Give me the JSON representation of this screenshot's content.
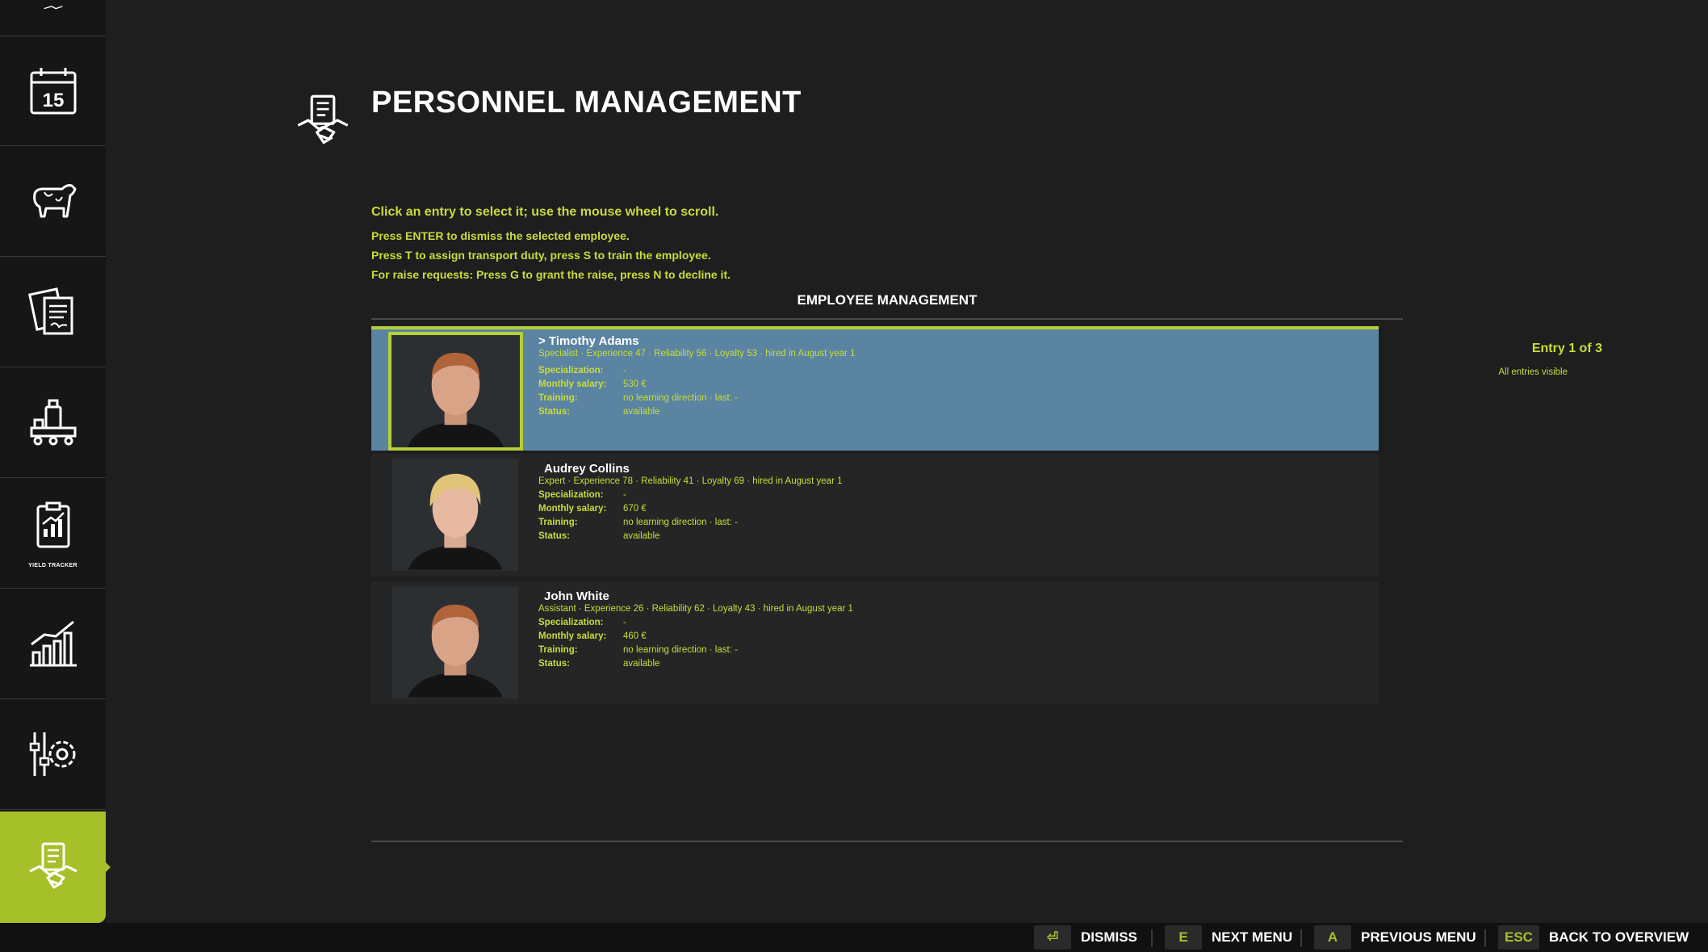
{
  "header": {
    "title": "PERSONNEL MANAGEMENT"
  },
  "sidebar": {
    "items": [
      {
        "name": "calendar",
        "icon": "calendar-icon",
        "text": "15"
      },
      {
        "name": "animals",
        "icon": "cow-icon"
      },
      {
        "name": "contracts",
        "icon": "contracts-icon"
      },
      {
        "name": "production",
        "icon": "production-icon"
      },
      {
        "name": "yield-tracker",
        "icon": "yield-tracker-icon",
        "label": "YIELD TRACKER"
      },
      {
        "name": "statistics",
        "icon": "statistics-icon"
      },
      {
        "name": "settings",
        "icon": "settings-icon"
      },
      {
        "name": "personnel",
        "icon": "handshake-icon",
        "active": true
      }
    ]
  },
  "instructions": {
    "line0": "Click an entry to select it; use the mouse wheel to scroll.",
    "line1": "Press ENTER to dismiss the selected employee.",
    "line2": "Press T to assign transport duty, press S to train the employee.",
    "line3": "For raise requests: Press G to grant the raise, press N to decline it."
  },
  "section": {
    "title": "EMPLOYEE MANAGEMENT"
  },
  "labels": {
    "specialization": "Specialization:",
    "salary": "Monthly salary:",
    "training": "Training:",
    "status": "Status:"
  },
  "employees": [
    {
      "name": "> Timothy Adams",
      "summary": "Specialist · Experience 47 · Reliability 56 · Loyalty 53 · hired in August year 1",
      "specialization": "-",
      "salary": "530 €",
      "training": "no learning direction · last: -",
      "status": "available",
      "hair": "#b0643a"
    },
    {
      "name": "Audrey Collins",
      "summary": "Expert · Experience 78 · Reliability 41 · Loyalty 69 · hired in August year 1",
      "specialization": "-",
      "salary": "670 €",
      "training": "no learning direction · last: -",
      "status": "available",
      "hair": "#e0c478"
    },
    {
      "name": "John White",
      "summary": "Assistant · Experience 26 · Reliability 62 · Loyalty 43 · hired in August year 1",
      "specialization": "-",
      "salary": "460 €",
      "training": "no learning direction · last: -",
      "status": "available",
      "hair": "#b0643a"
    }
  ],
  "pagination": {
    "entry": "Entry 1 of 3",
    "visible": "All entries visible"
  },
  "bottom_bar": {
    "dismiss": {
      "key": "⏎",
      "label": "DISMISS"
    },
    "next": {
      "key": "E",
      "label": "NEXT MENU"
    },
    "previous": {
      "key": "A",
      "label": "PREVIOUS MENU"
    },
    "back": {
      "key": "ESC",
      "label": "BACK TO OVERVIEW"
    }
  },
  "colors": {
    "accent": "#a6c02a",
    "text_accent": "#c8dc3c",
    "selected_row": "#5a84a1"
  }
}
